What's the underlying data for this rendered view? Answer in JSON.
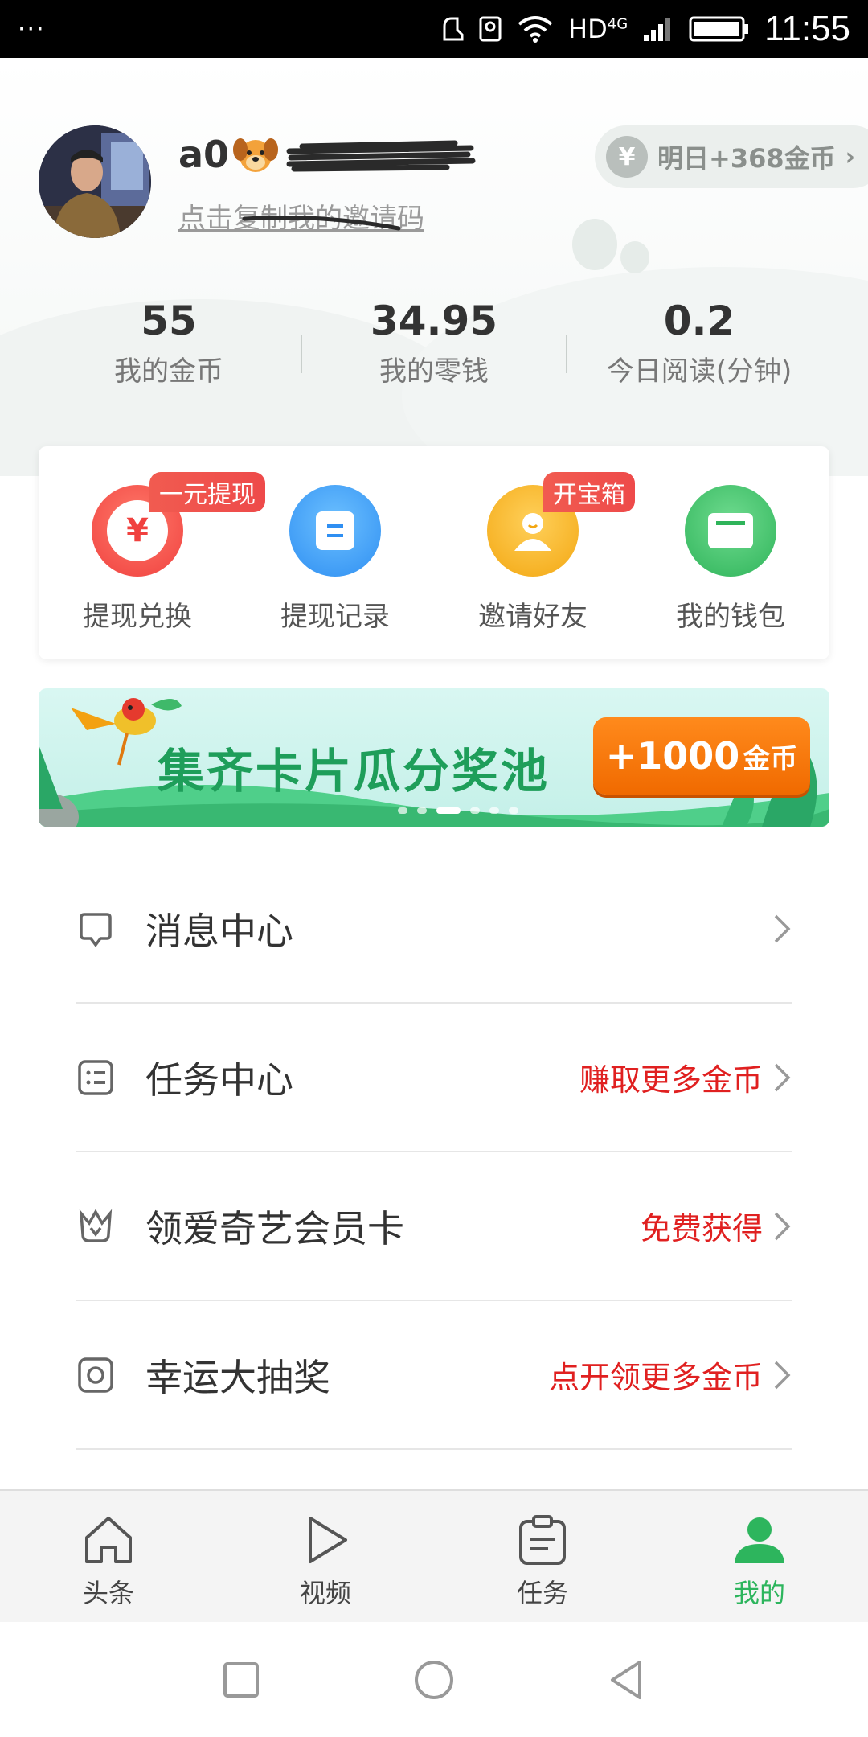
{
  "status_bar": {
    "menu_dots": "···",
    "network": "HD",
    "network_type": "4G",
    "time": "11:55"
  },
  "profile": {
    "username": "a0",
    "invite_link": "点击复制我的邀请码",
    "tomorrow_reward": "明日+368金币",
    "tomorrow_icon": "¥"
  },
  "stats": [
    {
      "value": "55",
      "label": "我的金币"
    },
    {
      "value": "34.95",
      "label": "我的零钱"
    },
    {
      "value": "0.2",
      "label": "今日阅读(分钟)"
    }
  ],
  "actions": [
    {
      "label": "提现兑换",
      "badge": "一元提现",
      "icon": "yen-coin-icon",
      "color": "#f44a4a",
      "glyph": "¥"
    },
    {
      "label": "提现记录",
      "badge": "",
      "icon": "record-icon",
      "color": "#3ea0f5"
    },
    {
      "label": "邀请好友",
      "badge": "开宝箱",
      "icon": "invite-friend-icon",
      "color": "#f6b21a"
    },
    {
      "label": "我的钱包",
      "badge": "",
      "icon": "wallet-icon",
      "color": "#3cc06a"
    }
  ],
  "banner": {
    "title": "集齐卡片瓜分奖池",
    "reward_amount": "+1000",
    "reward_unit": "金币",
    "active_slide": 3,
    "slide_count": 6
  },
  "menu": [
    {
      "label": "消息中心",
      "extra": "",
      "icon": "message-icon"
    },
    {
      "label": "任务中心",
      "extra": "赚取更多金币",
      "icon": "task-list-icon"
    },
    {
      "label": "领爱奇艺会员卡",
      "extra": "免费获得",
      "icon": "vip-crown-icon"
    },
    {
      "label": "幸运大抽奖",
      "extra": "点开领更多金币",
      "icon": "lottery-icon"
    }
  ],
  "bottom_nav": [
    {
      "label": "头条",
      "icon": "home-icon",
      "active": false
    },
    {
      "label": "视频",
      "icon": "play-icon",
      "active": false
    },
    {
      "label": "任务",
      "icon": "clipboard-icon",
      "active": false
    },
    {
      "label": "我的",
      "icon": "profile-icon",
      "active": true
    }
  ],
  "colors": {
    "accent_green": "#2db55d",
    "red_text": "#e02020",
    "orange": "#f06a00"
  }
}
